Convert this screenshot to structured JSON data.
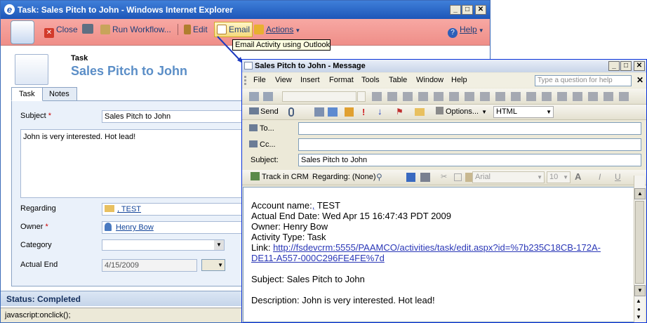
{
  "ie": {
    "title": "Task: Sales Pitch to John - Windows Internet Explorer",
    "toolbar": {
      "close": "Close",
      "run_workflow": "Run Workflow...",
      "edit": "Edit",
      "email": "Email",
      "actions": "Actions",
      "help": "Help"
    },
    "tooltip": "Email Activity using Outlook",
    "entity_label": "Task",
    "record_title": "Sales Pitch to John",
    "tabs": [
      "Task",
      "Notes"
    ],
    "fields": {
      "subject_label": "Subject",
      "subject_value": "Sales Pitch to John",
      "description_value": "John is very interested. Hot lead!",
      "regarding_label": "Regarding",
      "regarding_value": ", TEST",
      "owner_label": "Owner",
      "owner_value": "Henry Bow",
      "category_label": "Category",
      "category_value": "",
      "actual_end_label": "Actual End",
      "actual_end_value": "4/15/2009"
    },
    "status": "Status: Completed",
    "statusbar": "javascript:onclick();"
  },
  "outlook": {
    "title": "Sales Pitch to John - Message",
    "menu": [
      "File",
      "View",
      "Insert",
      "Format",
      "Tools",
      "Table",
      "Window",
      "Help"
    ],
    "ask_placeholder": "Type a question for help",
    "toolbar": {
      "send": "Send",
      "options": "Options...",
      "format": "HTML",
      "track": "Track in CRM",
      "regarding": "Regarding: (None)",
      "font": "Arial",
      "size": "10"
    },
    "header": {
      "to_label": "To...",
      "cc_label": "Cc...",
      "subject_label": "Subject:",
      "to_value": "",
      "cc_value": "",
      "subject_value": "Sales Pitch to John"
    },
    "body": {
      "account_prefix": "Account name:",
      "account_link": ",",
      "account_suffix": " TEST",
      "actual_end": "Actual End Date: Wed Apr 15 16:47:43 PDT 2009",
      "owner": "Owner: Henry Bow",
      "activity_type": "Activity Type: Task",
      "link_label": "Link: ",
      "link_url_1": "http://fsdevcrm:5555/PAAMCO/activities/task/edit.aspx?id=%7b235C18CB-172A-",
      "link_url_2": "DE11-A557-000C296FE4FE%7d",
      "subject": "Subject: Sales Pitch to John",
      "description": "Description: John is very interested. Hot lead!"
    }
  },
  "colors": {
    "ie_title": "#1d56b8",
    "crm_toolbar": "#ef8e88",
    "form_panel": "#eaf1fa",
    "link": "#12449a"
  }
}
